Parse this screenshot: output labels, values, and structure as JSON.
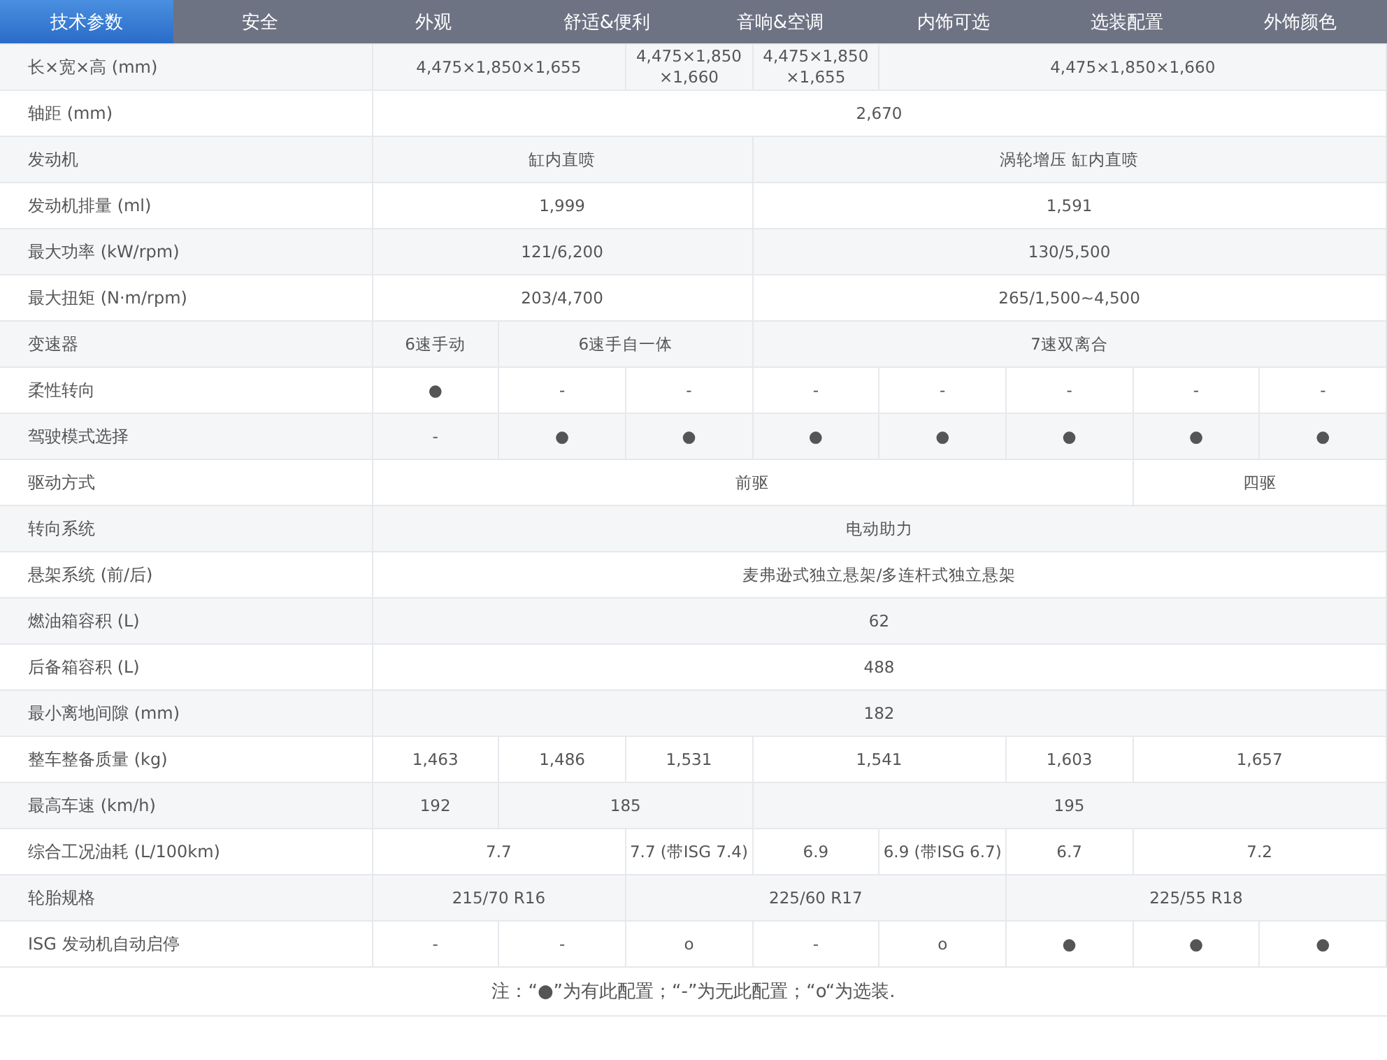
{
  "tabs": [
    {
      "label": "技术参数",
      "selected": true
    },
    {
      "label": "安全",
      "selected": false
    },
    {
      "label": "外观",
      "selected": false
    },
    {
      "label": "舒适&便利",
      "selected": false
    },
    {
      "label": "音响&空调",
      "selected": false
    },
    {
      "label": "内饰可选",
      "selected": false
    },
    {
      "label": "选装配置",
      "selected": false
    },
    {
      "label": "外饰颜色",
      "selected": false
    }
  ],
  "rows": [
    {
      "label": "长×宽×高 (mm)",
      "cells": [
        "4,475×1,850×1,655",
        "4,475×1,850 ×1,660",
        "4,475×1,850 ×1,655",
        "4,475×1,850×1,660"
      ]
    },
    {
      "label": "轴距 (mm)",
      "cells": [
        "2,670"
      ]
    },
    {
      "label": "发动机",
      "cells": [
        "缸内直喷",
        "涡轮增压 缸内直喷"
      ]
    },
    {
      "label": "发动机排量 (ml)",
      "cells": [
        "1,999",
        "1,591"
      ]
    },
    {
      "label": "最大功率 (kW/rpm)",
      "cells": [
        "121/6,200",
        "130/5,500"
      ]
    },
    {
      "label": "最大扭矩 (N·m/rpm)",
      "cells": [
        "203/4,700",
        "265/1,500~4,500"
      ]
    },
    {
      "label": "变速器",
      "cells": [
        "6速手动",
        "6速手自一体",
        "7速双离合"
      ]
    },
    {
      "label": "柔性转向",
      "cells": [
        "●",
        "-",
        "-",
        "-",
        "-",
        "-",
        "-",
        "-"
      ]
    },
    {
      "label": "驾驶模式选择",
      "cells": [
        "-",
        "●",
        "●",
        "●",
        "●",
        "●",
        "●",
        "●"
      ]
    },
    {
      "label": "驱动方式",
      "cells": [
        "前驱",
        "四驱"
      ]
    },
    {
      "label": "转向系统",
      "cells": [
        "电动助力"
      ]
    },
    {
      "label": "悬架系统 (前/后)",
      "cells": [
        "麦弗逊式独立悬架/多连杆式独立悬架"
      ]
    },
    {
      "label": "燃油箱容积 (L)",
      "cells": [
        "62"
      ]
    },
    {
      "label": "后备箱容积 (L)",
      "cells": [
        "488"
      ]
    },
    {
      "label": "最小离地间隙 (mm)",
      "cells": [
        "182"
      ]
    },
    {
      "label": "整车整备质量 (kg)",
      "cells": [
        "1,463",
        "1,486",
        "1,531",
        "1,541",
        "1,603",
        "1,657"
      ]
    },
    {
      "label": "最高车速 (km/h)",
      "cells": [
        "192",
        "185",
        "195"
      ]
    },
    {
      "label": "综合工况油耗 (L/100km)",
      "cells": [
        "7.7",
        "7.7 (带ISG 7.4)",
        "6.9",
        "6.9 (带ISG 6.7)",
        "6.7",
        "7.2"
      ]
    },
    {
      "label": "轮胎规格",
      "cells": [
        "215/70 R16",
        "225/60 R17",
        "225/55 R18"
      ]
    },
    {
      "label": "ISG 发动机自动启停",
      "cells": [
        "-",
        "-",
        "o",
        "-",
        "o",
        "●",
        "●",
        "●"
      ]
    }
  ],
  "note": "注：“●”为有此配置；“-”为无此配置；“o“为选装."
}
